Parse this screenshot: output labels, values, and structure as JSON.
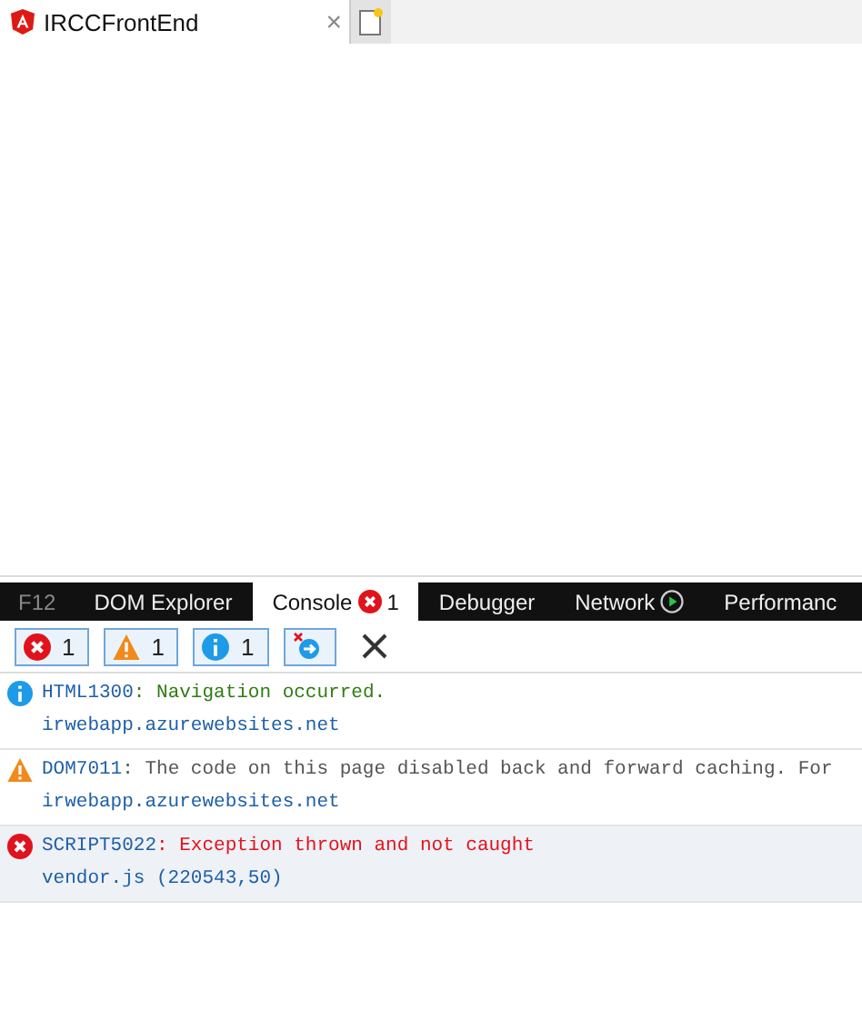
{
  "browser_tab": {
    "title": "IRCCFrontEnd",
    "close": "×"
  },
  "devtools": {
    "label": "F12",
    "tabs": [
      {
        "label": "DOM Explorer",
        "selected": false
      },
      {
        "label": "Console",
        "selected": true,
        "badge": {
          "kind": "error",
          "count": "1"
        }
      },
      {
        "label": "Debugger",
        "selected": false
      },
      {
        "label": "Network",
        "selected": false,
        "badge": {
          "kind": "play"
        }
      },
      {
        "label": "Performanc",
        "selected": false
      }
    ],
    "filters": [
      {
        "kind": "error",
        "count": "1",
        "selected": true
      },
      {
        "kind": "warning",
        "count": "1",
        "selected": true
      },
      {
        "kind": "info",
        "count": "1",
        "selected": true
      }
    ],
    "messages": [
      {
        "kind": "info",
        "code": "HTML1300",
        "text": ": Navigation occurred.",
        "source": "irwebapp.azurewebsites.net"
      },
      {
        "kind": "warning",
        "code": "DOM7011",
        "text": ": The code on this page disabled back and forward caching. For",
        "source": "irwebapp.azurewebsites.net"
      },
      {
        "kind": "error",
        "code": "SCRIPT5022",
        "text": ": Exception thrown and not caught",
        "source": "vendor.js (220543,50)"
      }
    ]
  }
}
